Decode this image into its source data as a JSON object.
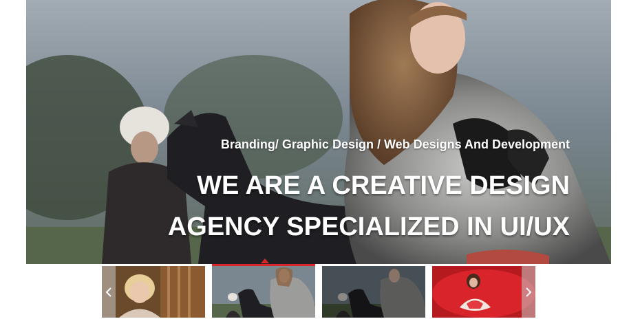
{
  "hero": {
    "subtitle": "Branding/ Graphic Design / Web Designs And Development",
    "title_line1": "WE ARE A CREATIVE DESIGN",
    "title_line2": "AGENCY SPECIALIZED IN UI/UX"
  },
  "thumbnails": [
    {
      "name": "blonde-portrait",
      "active": false
    },
    {
      "name": "fur-coat-horse",
      "active": true
    },
    {
      "name": "fur-coat-horse-dark",
      "active": false
    },
    {
      "name": "red-dress",
      "active": false
    }
  ],
  "nav": {
    "prev_icon": "chevron-left-icon",
    "next_icon": "chevron-right-icon"
  },
  "colors": {
    "accent": "#d9262b",
    "text": "#ffffff"
  }
}
